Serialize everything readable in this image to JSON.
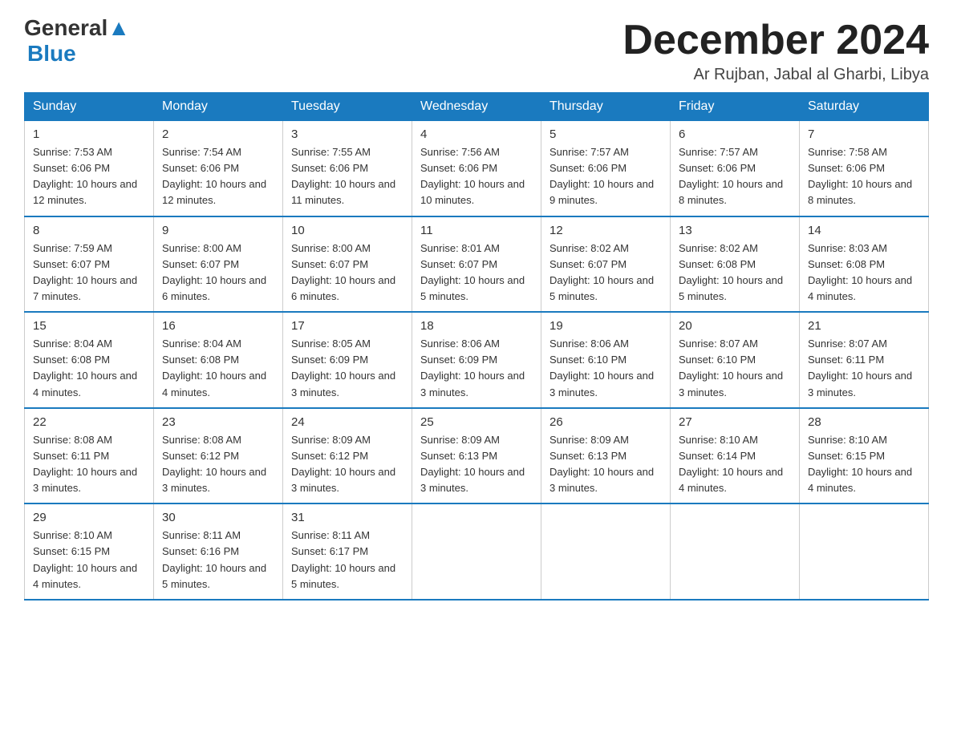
{
  "header": {
    "logo_text_black": "General",
    "logo_text_blue": "Blue",
    "month_title": "December 2024",
    "location": "Ar Rujban, Jabal al Gharbi, Libya"
  },
  "weekdays": [
    "Sunday",
    "Monday",
    "Tuesday",
    "Wednesday",
    "Thursday",
    "Friday",
    "Saturday"
  ],
  "weeks": [
    [
      {
        "day": "1",
        "sunrise": "7:53 AM",
        "sunset": "6:06 PM",
        "daylight": "10 hours and 12 minutes."
      },
      {
        "day": "2",
        "sunrise": "7:54 AM",
        "sunset": "6:06 PM",
        "daylight": "10 hours and 12 minutes."
      },
      {
        "day": "3",
        "sunrise": "7:55 AM",
        "sunset": "6:06 PM",
        "daylight": "10 hours and 11 minutes."
      },
      {
        "day": "4",
        "sunrise": "7:56 AM",
        "sunset": "6:06 PM",
        "daylight": "10 hours and 10 minutes."
      },
      {
        "day": "5",
        "sunrise": "7:57 AM",
        "sunset": "6:06 PM",
        "daylight": "10 hours and 9 minutes."
      },
      {
        "day": "6",
        "sunrise": "7:57 AM",
        "sunset": "6:06 PM",
        "daylight": "10 hours and 8 minutes."
      },
      {
        "day": "7",
        "sunrise": "7:58 AM",
        "sunset": "6:06 PM",
        "daylight": "10 hours and 8 minutes."
      }
    ],
    [
      {
        "day": "8",
        "sunrise": "7:59 AM",
        "sunset": "6:07 PM",
        "daylight": "10 hours and 7 minutes."
      },
      {
        "day": "9",
        "sunrise": "8:00 AM",
        "sunset": "6:07 PM",
        "daylight": "10 hours and 6 minutes."
      },
      {
        "day": "10",
        "sunrise": "8:00 AM",
        "sunset": "6:07 PM",
        "daylight": "10 hours and 6 minutes."
      },
      {
        "day": "11",
        "sunrise": "8:01 AM",
        "sunset": "6:07 PM",
        "daylight": "10 hours and 5 minutes."
      },
      {
        "day": "12",
        "sunrise": "8:02 AM",
        "sunset": "6:07 PM",
        "daylight": "10 hours and 5 minutes."
      },
      {
        "day": "13",
        "sunrise": "8:02 AM",
        "sunset": "6:08 PM",
        "daylight": "10 hours and 5 minutes."
      },
      {
        "day": "14",
        "sunrise": "8:03 AM",
        "sunset": "6:08 PM",
        "daylight": "10 hours and 4 minutes."
      }
    ],
    [
      {
        "day": "15",
        "sunrise": "8:04 AM",
        "sunset": "6:08 PM",
        "daylight": "10 hours and 4 minutes."
      },
      {
        "day": "16",
        "sunrise": "8:04 AM",
        "sunset": "6:08 PM",
        "daylight": "10 hours and 4 minutes."
      },
      {
        "day": "17",
        "sunrise": "8:05 AM",
        "sunset": "6:09 PM",
        "daylight": "10 hours and 3 minutes."
      },
      {
        "day": "18",
        "sunrise": "8:06 AM",
        "sunset": "6:09 PM",
        "daylight": "10 hours and 3 minutes."
      },
      {
        "day": "19",
        "sunrise": "8:06 AM",
        "sunset": "6:10 PM",
        "daylight": "10 hours and 3 minutes."
      },
      {
        "day": "20",
        "sunrise": "8:07 AM",
        "sunset": "6:10 PM",
        "daylight": "10 hours and 3 minutes."
      },
      {
        "day": "21",
        "sunrise": "8:07 AM",
        "sunset": "6:11 PM",
        "daylight": "10 hours and 3 minutes."
      }
    ],
    [
      {
        "day": "22",
        "sunrise": "8:08 AM",
        "sunset": "6:11 PM",
        "daylight": "10 hours and 3 minutes."
      },
      {
        "day": "23",
        "sunrise": "8:08 AM",
        "sunset": "6:12 PM",
        "daylight": "10 hours and 3 minutes."
      },
      {
        "day": "24",
        "sunrise": "8:09 AM",
        "sunset": "6:12 PM",
        "daylight": "10 hours and 3 minutes."
      },
      {
        "day": "25",
        "sunrise": "8:09 AM",
        "sunset": "6:13 PM",
        "daylight": "10 hours and 3 minutes."
      },
      {
        "day": "26",
        "sunrise": "8:09 AM",
        "sunset": "6:13 PM",
        "daylight": "10 hours and 3 minutes."
      },
      {
        "day": "27",
        "sunrise": "8:10 AM",
        "sunset": "6:14 PM",
        "daylight": "10 hours and 4 minutes."
      },
      {
        "day": "28",
        "sunrise": "8:10 AM",
        "sunset": "6:15 PM",
        "daylight": "10 hours and 4 minutes."
      }
    ],
    [
      {
        "day": "29",
        "sunrise": "8:10 AM",
        "sunset": "6:15 PM",
        "daylight": "10 hours and 4 minutes."
      },
      {
        "day": "30",
        "sunrise": "8:11 AM",
        "sunset": "6:16 PM",
        "daylight": "10 hours and 5 minutes."
      },
      {
        "day": "31",
        "sunrise": "8:11 AM",
        "sunset": "6:17 PM",
        "daylight": "10 hours and 5 minutes."
      },
      null,
      null,
      null,
      null
    ]
  ]
}
